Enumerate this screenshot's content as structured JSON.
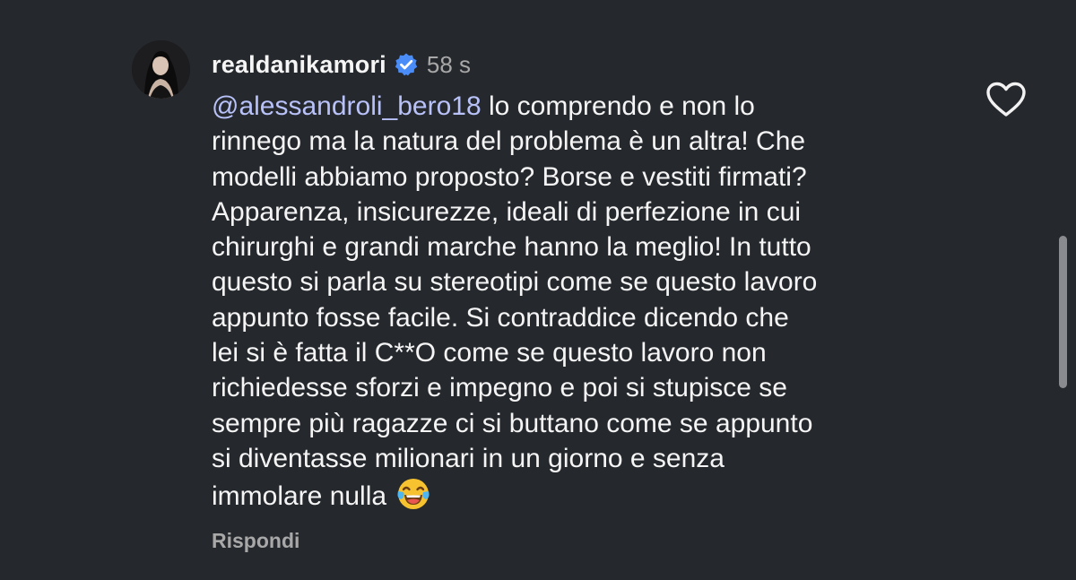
{
  "comment": {
    "username": "realdanikamori",
    "verified_icon": "verified-badge-icon",
    "timestamp": "58 s",
    "mention": "@alessandroli_bero18",
    "lines": [
      " lo comprendo e non lo",
      "rinnego ma la natura del problema è un altra! Che",
      "modelli abbiamo proposto? Borse e vestiti firmati?",
      "Apparenza, insicurezze, ideali di perfezione in cui",
      "chirurghi e grandi marche hanno la meglio! In tutto",
      "questo si parla su stereotipi come se questo lavoro",
      "appunto fosse facile. Si contraddice dicendo che",
      "lei si è fatta il C**O come se questo lavoro non",
      "richiedesse sforzi e impegno e poi si stupisce se",
      "sempre più ragazze ci si buttano come se appunto",
      "si diventasse milionari in un giorno e senza",
      "immolare nulla "
    ],
    "emoji": "face-with-tears-of-joy-icon",
    "reply_label": "Rispondi",
    "like_icon": "heart-outline-icon"
  },
  "colors": {
    "background": "#25282d",
    "mention": "#b8c2f8",
    "verified": "#4a8df8",
    "muted_text": "#a8a8a8"
  }
}
